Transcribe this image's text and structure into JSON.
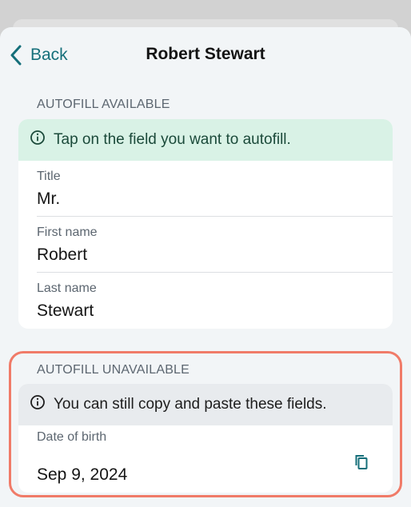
{
  "nav": {
    "back_label": "Back",
    "title": "Robert Stewart"
  },
  "autofill_available": {
    "section_label": "AUTOFILL AVAILABLE",
    "banner_text": "Tap on the field you want to autofill.",
    "fields": [
      {
        "label": "Title",
        "value": "Mr."
      },
      {
        "label": "First name",
        "value": "Robert"
      },
      {
        "label": "Last name",
        "value": "Stewart"
      }
    ]
  },
  "autofill_unavailable": {
    "section_label": "AUTOFILL UNAVAILABLE",
    "banner_text": "You can still copy and paste these fields.",
    "fields": [
      {
        "label": "Date of birth",
        "value": "Sep 9, 2024"
      }
    ]
  },
  "icons": {
    "back": "chevron-left-icon",
    "info": "info-circle-icon",
    "copy": "copy-icon"
  },
  "colors": {
    "accent": "#156f7a",
    "available_banner": "#d9f2e6",
    "unavailable_banner": "#e8ebee",
    "highlight_border": "#f07b68"
  }
}
